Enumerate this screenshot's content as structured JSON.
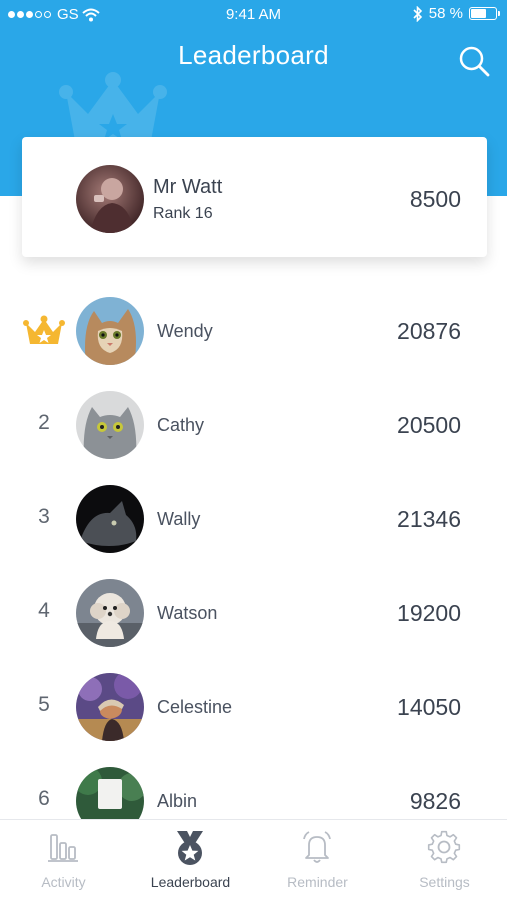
{
  "status_bar": {
    "carrier": "GS",
    "time": "9:41 AM",
    "battery": "58 %"
  },
  "header": {
    "title": "Leaderboard"
  },
  "my_entry": {
    "name": "Mr Watt",
    "rank_label": "Rank 16",
    "score": "8500"
  },
  "leaderboard": [
    {
      "rank": "",
      "name": "Wendy",
      "score": "20876"
    },
    {
      "rank": "2",
      "name": "Cathy",
      "score": "20500"
    },
    {
      "rank": "3",
      "name": "Wally",
      "score": "21346"
    },
    {
      "rank": "4",
      "name": "Watson",
      "score": "19200"
    },
    {
      "rank": "5",
      "name": "Celestine",
      "score": "14050"
    },
    {
      "rank": "6",
      "name": "Albin",
      "score": "9826"
    }
  ],
  "tabs": [
    {
      "label": "Activity",
      "icon": "bar-chart-icon"
    },
    {
      "label": "Leaderboard",
      "icon": "medal-icon"
    },
    {
      "label": "Reminder",
      "icon": "bell-icon"
    },
    {
      "label": "Settings",
      "icon": "gear-icon"
    }
  ],
  "colors": {
    "header_blue": "#2aa7e8",
    "crown_gold": "#f5b731",
    "text_dark": "#3b4350",
    "tab_inactive": "#b7bcc4"
  }
}
